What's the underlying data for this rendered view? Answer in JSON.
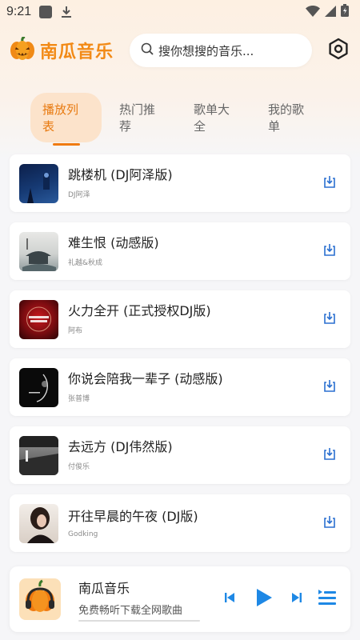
{
  "status_bar": {
    "time": "9:21"
  },
  "header": {
    "app_name": "南瓜音乐",
    "search_placeholder": "搜你想搜的音乐...",
    "settings_icon": "settings-hexagon-icon"
  },
  "tabs": [
    {
      "label": "播放列表",
      "active": true
    },
    {
      "label": "热门推荐",
      "active": false
    },
    {
      "label": "歌单大全",
      "active": false
    },
    {
      "label": "我的歌单",
      "active": false
    }
  ],
  "songs": [
    {
      "title": "跳楼机 (DJ阿泽版)",
      "artist": "DJ阿泽"
    },
    {
      "title": "难生恨 (动感版)",
      "artist": "礼越&秋成"
    },
    {
      "title": "火力全开 (正式授权DJ版)",
      "artist": "阿布"
    },
    {
      "title": "你说会陪我一辈子 (动感版)",
      "artist": "张普博"
    },
    {
      "title": "去远方 (DJ伟然版)",
      "artist": "付俊乐"
    },
    {
      "title": "开往早晨的午夜 (DJ版)",
      "artist": "Godking"
    }
  ],
  "player": {
    "title": "南瓜音乐",
    "subtitle": "免费畅听下载全网歌曲",
    "progress": 0
  },
  "colors": {
    "accent": "#f07a10",
    "tab_active_bg": "#fce3cb",
    "logo": "#f28a16",
    "control_blue": "#1e88e5"
  }
}
